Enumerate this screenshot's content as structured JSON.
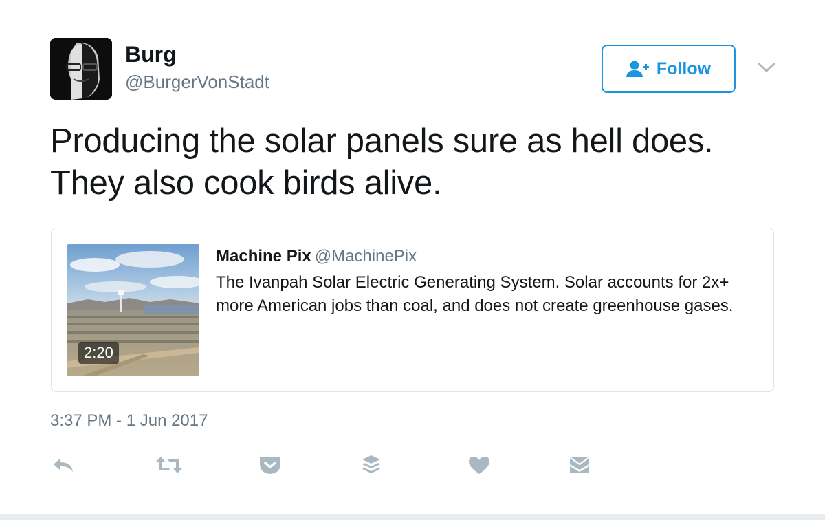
{
  "author": {
    "display_name": "Burg",
    "screen_name": "@BurgerVonStadt"
  },
  "follow_button": {
    "label": "Follow",
    "icon": "follow-person-plus-icon"
  },
  "more_menu_icon": "chevron-down-icon",
  "tweet": {
    "text": "Producing the solar panels sure as hell does. They also cook birds alive.",
    "timestamp": "3:37 PM - 1 Jun 2017"
  },
  "quoted_tweet": {
    "author_name": "Machine Pix",
    "author_handle": "@MachinePix",
    "text": "The Ivanpah Solar Electric Generating System. Solar accounts for 2x+ more American jobs than coal, and does not create greenhouse gases.",
    "video_duration": "2:20"
  },
  "actions": [
    {
      "name": "reply",
      "icon": "reply-icon"
    },
    {
      "name": "retweet",
      "icon": "retweet-icon"
    },
    {
      "name": "pocket",
      "icon": "pocket-icon"
    },
    {
      "name": "buffer",
      "icon": "buffer-icon"
    },
    {
      "name": "like",
      "icon": "heart-icon"
    },
    {
      "name": "direct-message",
      "icon": "envelope-icon"
    }
  ],
  "colors": {
    "accent": "#1b95e0",
    "secondary_text": "#657786",
    "action_icons": "#aab8c2",
    "card_border": "#dde3e8"
  }
}
